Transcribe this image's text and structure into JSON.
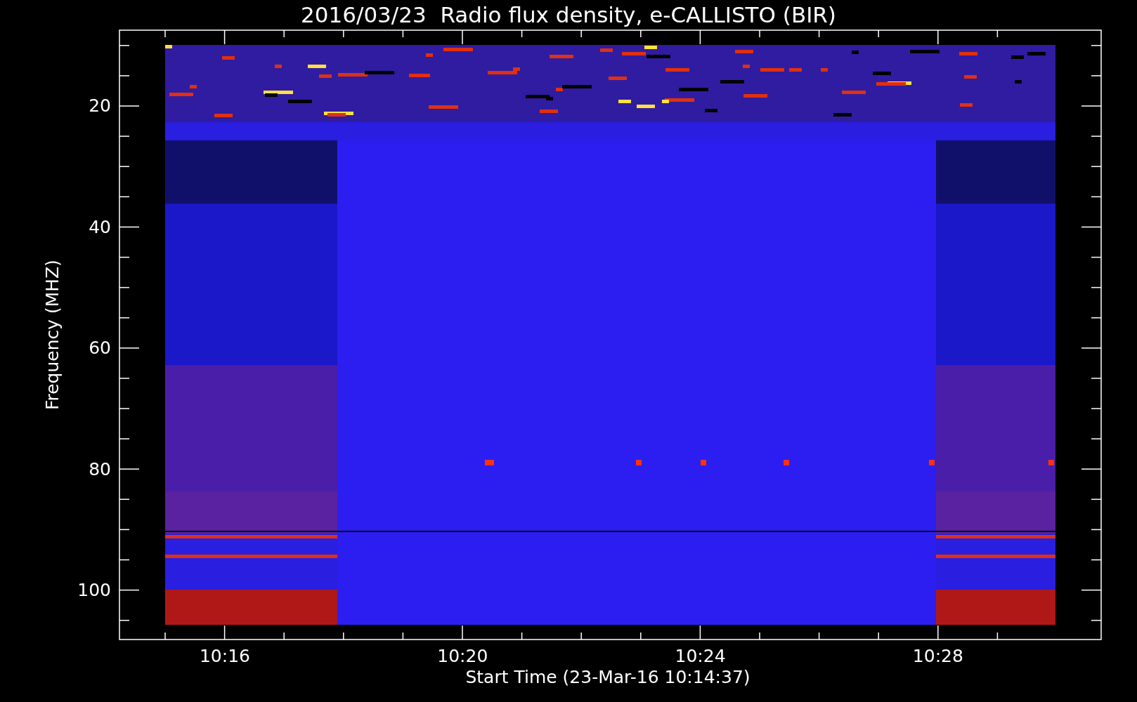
{
  "title": "2016/03/23  Radio flux density, e-CALLISTO (BIR)",
  "y_axis": {
    "label": "Frequency (MHZ)",
    "ticks": [
      "20",
      "40",
      "60",
      "80",
      "100"
    ]
  },
  "x_axis": {
    "label": "Start Time (23-Mar-16 10:14:37)",
    "ticks": [
      "10:16",
      "10:20",
      "10:24",
      "10:28"
    ]
  }
}
